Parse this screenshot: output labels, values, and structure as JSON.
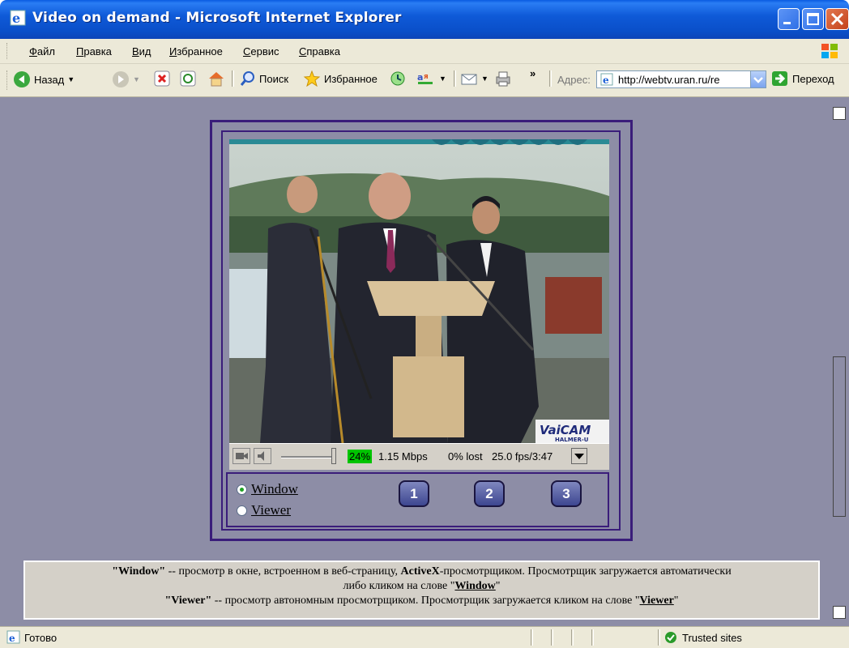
{
  "window": {
    "title": "Video on demand - Microsoft Internet Explorer"
  },
  "menu": [
    "Файл",
    "Правка",
    "Вид",
    "Избранное",
    "Сервис",
    "Справка"
  ],
  "toolbar": {
    "back": "Назад",
    "search": "Поиск",
    "favorites": "Избранное",
    "more": "»",
    "address_label": "Адрес:",
    "address_value": "http://webtv.uran.ru/re",
    "go": "Переход"
  },
  "player": {
    "logo": "VaiCAM",
    "logo_sub": "HALMER-U",
    "buffer_pct": "24%",
    "bitrate": "1.15 Mbps",
    "lost": "0% lost",
    "fps_time": "25.0 fps/3:47"
  },
  "selector": {
    "window_label": "Window",
    "viewer_label": "Viewer",
    "selected": "Window",
    "buttons": [
      "1",
      "2",
      "3"
    ]
  },
  "info": {
    "line1_bold": "\"Window\"",
    "line1_a": " -- просмотр в окне, встроенном в веб-страницу, ",
    "line1_bold2": "ActiveX",
    "line1_b": "-просмотрщиком. Просмотрщик загружается автоматически",
    "line2_a": "либо кликом на слове \"",
    "line2_link": "Window",
    "line2_b": "\"",
    "line3_bold": "\"Viewer\"",
    "line3_a": " -- просмотр автономным просмотрщиком. Просмотрщик загружается кликом на слове \"",
    "line3_link": "Viewer",
    "line3_b": "\""
  },
  "status": {
    "text": "Готово",
    "zone": "Trusted sites"
  },
  "colors": {
    "content_bg": "#8d8da6",
    "frame": "#3a1d7a",
    "titlebar": "#0a4fc9"
  }
}
